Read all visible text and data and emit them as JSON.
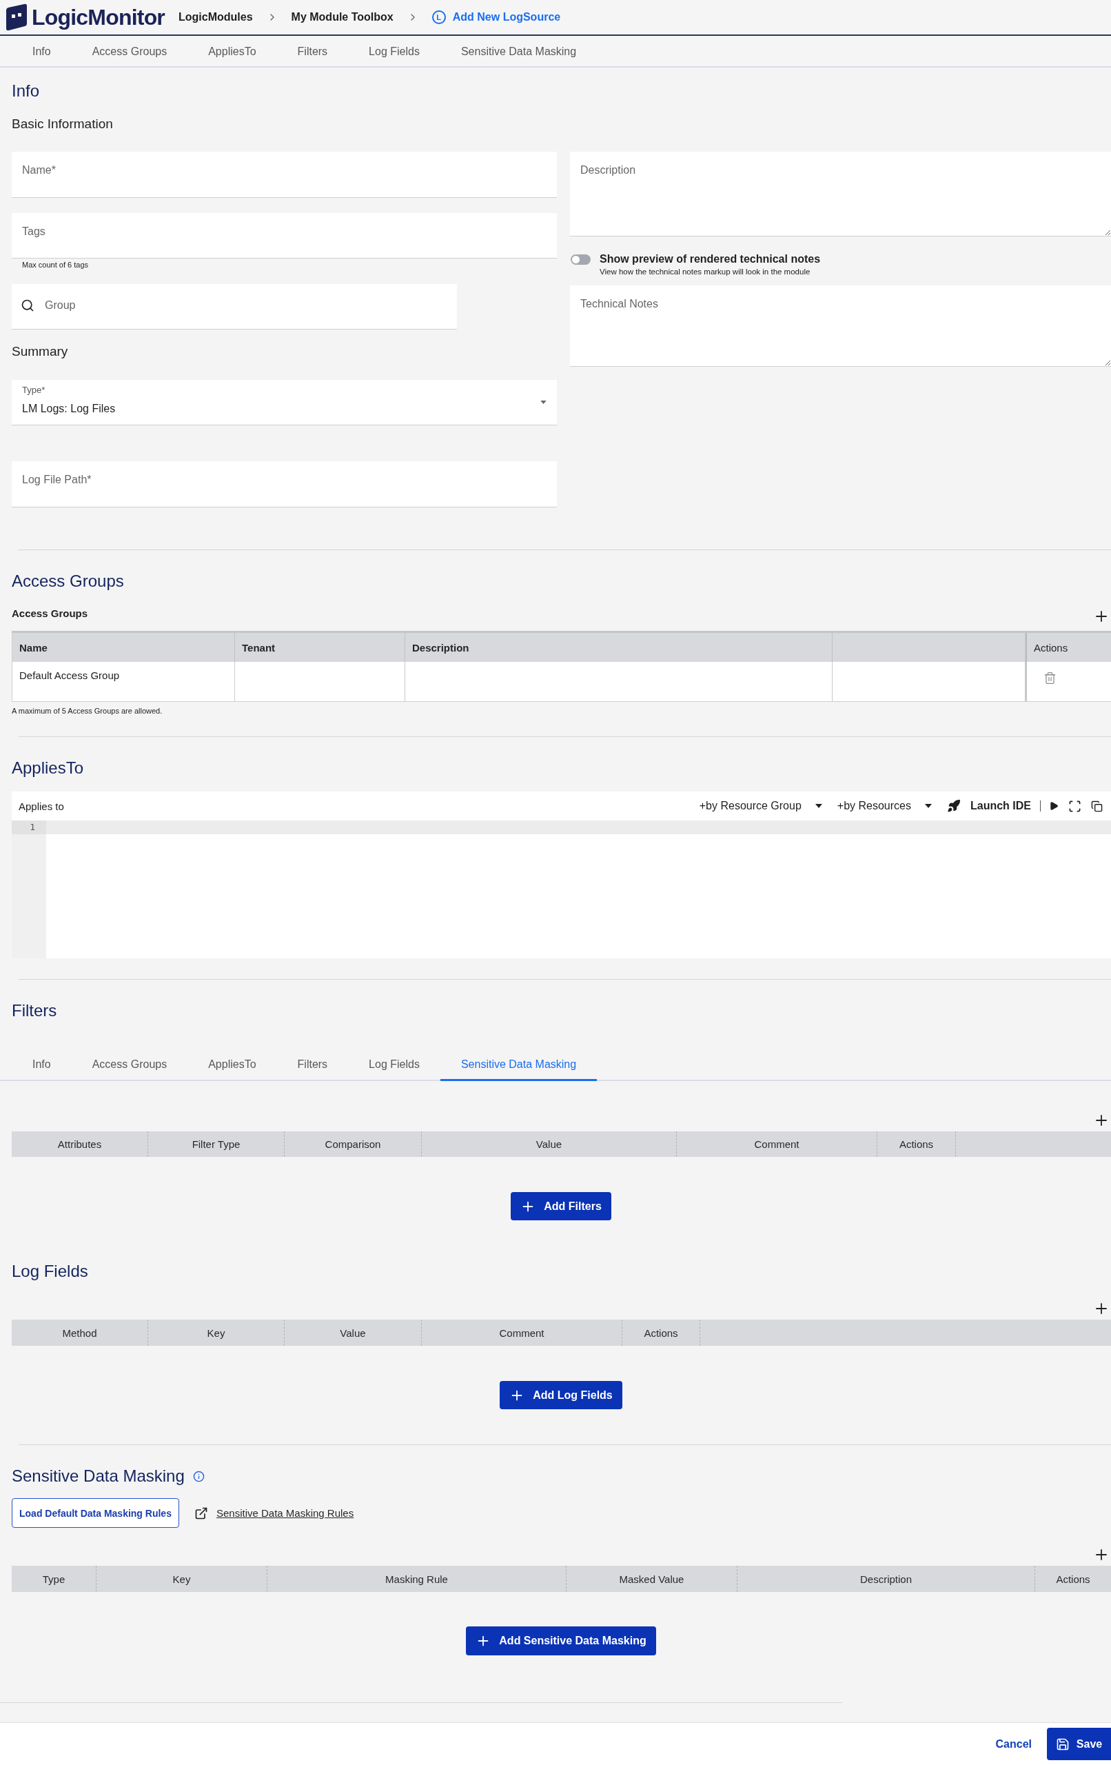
{
  "header": {
    "logo": "LogicMonitor",
    "breadcrumbs": [
      {
        "label": "LogicModules",
        "kind": "link"
      },
      {
        "label": "My Module Toolbox",
        "kind": "link"
      },
      {
        "label": "Add New LogSource",
        "kind": "current",
        "icon_letter": "L"
      }
    ]
  },
  "tabs": [
    {
      "label": "Info",
      "selected": false
    },
    {
      "label": "Access Groups",
      "selected": false
    },
    {
      "label": "AppliesTo",
      "selected": false
    },
    {
      "label": "Filters",
      "selected": false
    },
    {
      "label": "Log Fields",
      "selected": false
    },
    {
      "label": "Sensitive Data Masking",
      "selected": false
    }
  ],
  "info": {
    "title": "Info",
    "basic_title": "Basic Information",
    "name_field": {
      "placeholder": "Name*"
    },
    "tags_field": {
      "placeholder": "Tags",
      "hint": "Max count of 6 tags"
    },
    "group_field": {
      "placeholder": "Group"
    },
    "summary_title": "Summary",
    "type_select": {
      "label": "Type*",
      "value": "LM Logs: Log Files"
    },
    "log_file_path_field": {
      "placeholder": "Log File Path*"
    },
    "description_field": {
      "placeholder": "Description"
    },
    "preview_toggle": {
      "label": "Show preview of rendered technical notes",
      "hint": "View how the technical notes markup will look in the module",
      "on": false
    },
    "technical_notes_field": {
      "placeholder": "Technical Notes"
    }
  },
  "access_groups": {
    "title": "Access Groups",
    "subtitle": "Access Groups",
    "columns": [
      "Name",
      "Tenant",
      "Description"
    ],
    "actions_column": "Actions",
    "rows": [
      {
        "name": "Default Access Group"
      }
    ],
    "note": "A maximum of 5 Access Groups are allowed."
  },
  "applies_to": {
    "title": "AppliesTo",
    "label": "Applies to",
    "tools": [
      {
        "label": "+by Resource Group",
        "kind": "dropdown"
      },
      {
        "label": "+by Resources",
        "kind": "dropdown"
      },
      {
        "label": "Launch IDE",
        "kind": "launch"
      }
    ],
    "line_numbers": [
      "1"
    ]
  },
  "filters": {
    "title": "Filters",
    "tabs": [
      {
        "label": "Info",
        "selected": false
      },
      {
        "label": "Access Groups",
        "selected": false
      },
      {
        "label": "AppliesTo",
        "selected": false
      },
      {
        "label": "Filters",
        "selected": false
      },
      {
        "label": "Log Fields",
        "selected": false
      },
      {
        "label": "Sensitive Data Masking",
        "selected": true
      }
    ],
    "columns": [
      "Attributes",
      "Filter Type",
      "Comparison",
      "Value",
      "Comment",
      "Actions"
    ],
    "add_button": "Add Filters"
  },
  "log_fields": {
    "title": "Log Fields",
    "columns": [
      "Method",
      "Key",
      "Value",
      "Comment",
      "Actions"
    ],
    "add_button": "Add Log Fields"
  },
  "sensitive_data_masking": {
    "title": "Sensitive Data Masking",
    "load_button": "Load Default Data Masking Rules",
    "rules_link": "Sensitive Data Masking Rules",
    "columns": [
      "Type",
      "Key",
      "Masking Rule",
      "Masked Value",
      "Description",
      "Actions"
    ],
    "add_button": "Add Sensitive Data Masking"
  },
  "footer": {
    "cancel": "Cancel",
    "save": "Save"
  }
}
